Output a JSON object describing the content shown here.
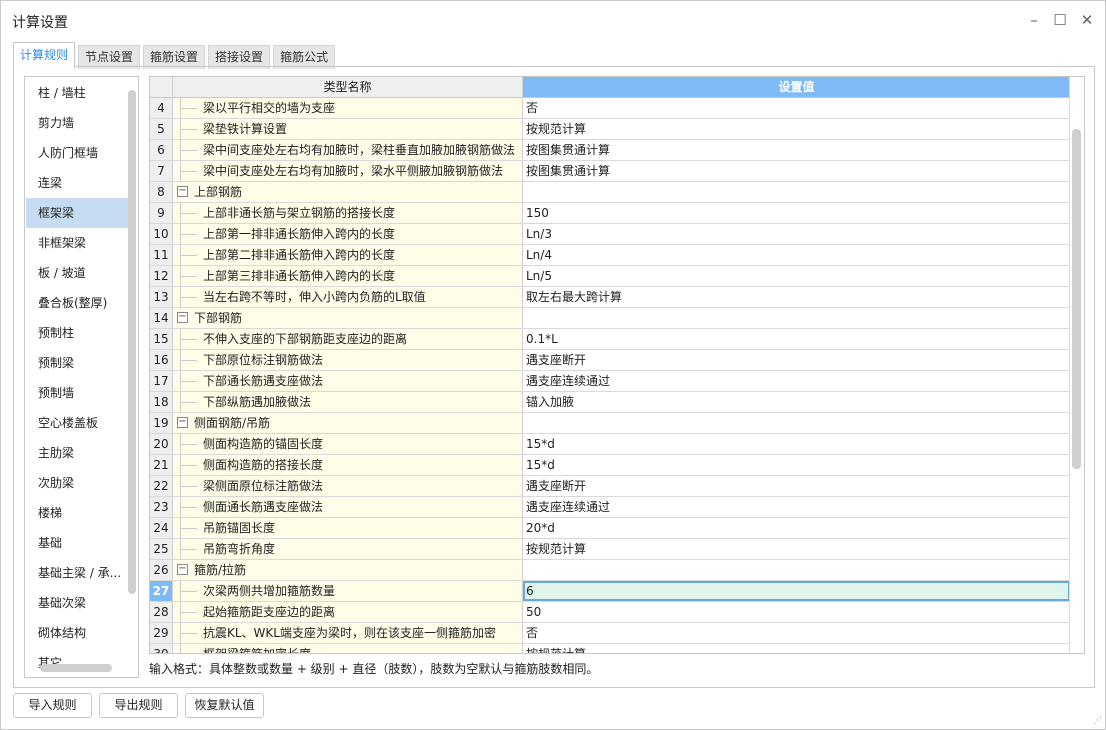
{
  "window": {
    "title": "计算设置",
    "controls": [
      "minimize",
      "maximize",
      "close"
    ]
  },
  "tabs": [
    {
      "label": "计算规则",
      "active": true
    },
    {
      "label": "节点设置"
    },
    {
      "label": "箍筋设置"
    },
    {
      "label": "搭接设置"
    },
    {
      "label": "箍筋公式"
    }
  ],
  "sidebar": {
    "selected": "框架梁",
    "items": [
      "柱 / 墙柱",
      "剪力墙",
      "人防门框墙",
      "连梁",
      "框架梁",
      "非框架梁",
      "板 / 坡道",
      "叠合板(整厚)",
      "预制柱",
      "预制梁",
      "预制墙",
      "空心楼盖板",
      "主肋梁",
      "次肋梁",
      "楼梯",
      "基础",
      "基础主梁 / 承...",
      "基础次梁",
      "砌体结构",
      "其它"
    ]
  },
  "grid": {
    "headers": {
      "num": "",
      "name": "类型名称",
      "value": "设置值"
    },
    "selected_row": "27",
    "rows": [
      {
        "n": "4",
        "name": "梁以平行相交的墙为支座",
        "value": "否"
      },
      {
        "n": "5",
        "name": "梁垫铁计算设置",
        "value": "按规范计算"
      },
      {
        "n": "6",
        "name": "梁中间支座处左右均有加腋时，梁柱垂直加腋加腋钢筋做法",
        "value": "按图集贯通计算"
      },
      {
        "n": "7",
        "name": "梁中间支座处左右均有加腋时，梁水平侧腋加腋钢筋做法",
        "value": "按图集贯通计算"
      },
      {
        "n": "8",
        "name": "上部钢筋",
        "value": "",
        "group": true
      },
      {
        "n": "9",
        "name": "上部非通长筋与架立钢筋的搭接长度",
        "value": "150"
      },
      {
        "n": "10",
        "name": "上部第一排非通长筋伸入跨内的长度",
        "value": "Ln/3"
      },
      {
        "n": "11",
        "name": "上部第二排非通长筋伸入跨内的长度",
        "value": "Ln/4"
      },
      {
        "n": "12",
        "name": "上部第三排非通长筋伸入跨内的长度",
        "value": "Ln/5"
      },
      {
        "n": "13",
        "name": "当左右跨不等时，伸入小跨内负筋的L取值",
        "value": "取左右最大跨计算"
      },
      {
        "n": "14",
        "name": "下部钢筋",
        "value": "",
        "group": true
      },
      {
        "n": "15",
        "name": "不伸入支座的下部钢筋距支座边的距离",
        "value": "0.1*L"
      },
      {
        "n": "16",
        "name": "下部原位标注钢筋做法",
        "value": "遇支座断开"
      },
      {
        "n": "17",
        "name": "下部通长筋遇支座做法",
        "value": "遇支座连续通过"
      },
      {
        "n": "18",
        "name": "下部纵筋遇加腋做法",
        "value": "锚入加腋"
      },
      {
        "n": "19",
        "name": "侧面钢筋/吊筋",
        "value": "",
        "group": true
      },
      {
        "n": "20",
        "name": "侧面构造筋的锚固长度",
        "value": "15*d"
      },
      {
        "n": "21",
        "name": "侧面构造筋的搭接长度",
        "value": "15*d"
      },
      {
        "n": "22",
        "name": "梁侧面原位标注筋做法",
        "value": "遇支座断开"
      },
      {
        "n": "23",
        "name": "侧面通长筋遇支座做法",
        "value": "遇支座连续通过"
      },
      {
        "n": "24",
        "name": "吊筋锚固长度",
        "value": "20*d"
      },
      {
        "n": "25",
        "name": "吊筋弯折角度",
        "value": "按规范计算"
      },
      {
        "n": "26",
        "name": "箍筋/拉筋",
        "value": "",
        "group": true
      },
      {
        "n": "27",
        "name": "次梁两侧共增加箍筋数量",
        "value": "6"
      },
      {
        "n": "28",
        "name": "起始箍筋距支座边的距离",
        "value": "50"
      },
      {
        "n": "29",
        "name": "抗震KL、WKL端支座为梁时，则在该支座一侧箍筋加密",
        "value": "否"
      },
      {
        "n": "30",
        "name": "框架梁箍筋加密长度",
        "value": "按规范计算"
      }
    ]
  },
  "hint": "输入格式：具体整数或数量 + 级别 + 直径（肢数），肢数为空默认与箍筋肢数相同。",
  "buttons": {
    "import": "导入规则",
    "export": "导出规则",
    "restore": "恢复默认值"
  },
  "colors": {
    "accent": "#7fbaf6",
    "name_bg": "#fffde8",
    "selected_value_bg": "#dff5ec",
    "sidebar_selected": "#c5dcf2"
  }
}
